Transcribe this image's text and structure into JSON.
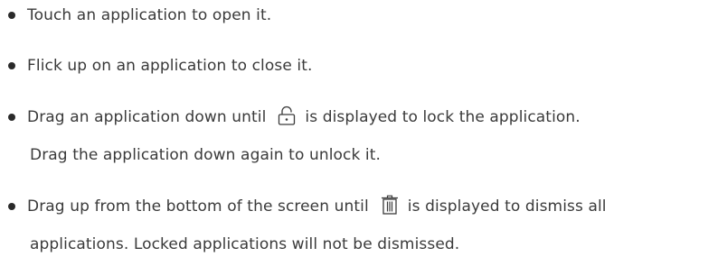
{
  "items": [
    {
      "lines": [
        "Touch an application to open it."
      ]
    },
    {
      "lines": [
        "Flick up on an application to close it."
      ]
    },
    {
      "line1_before_icon": "Drag an application down until",
      "icon": "lock-icon",
      "line1_after_icon": "is displayed to lock the application.",
      "line2": "Drag the application down again to unlock it."
    },
    {
      "line1_before_icon": "Drag up from the bottom of the screen until",
      "icon": "trash-icon",
      "line1_after_icon": "is displayed to dismiss all",
      "line2": "applications. Locked applications will not be dismissed."
    }
  ]
}
